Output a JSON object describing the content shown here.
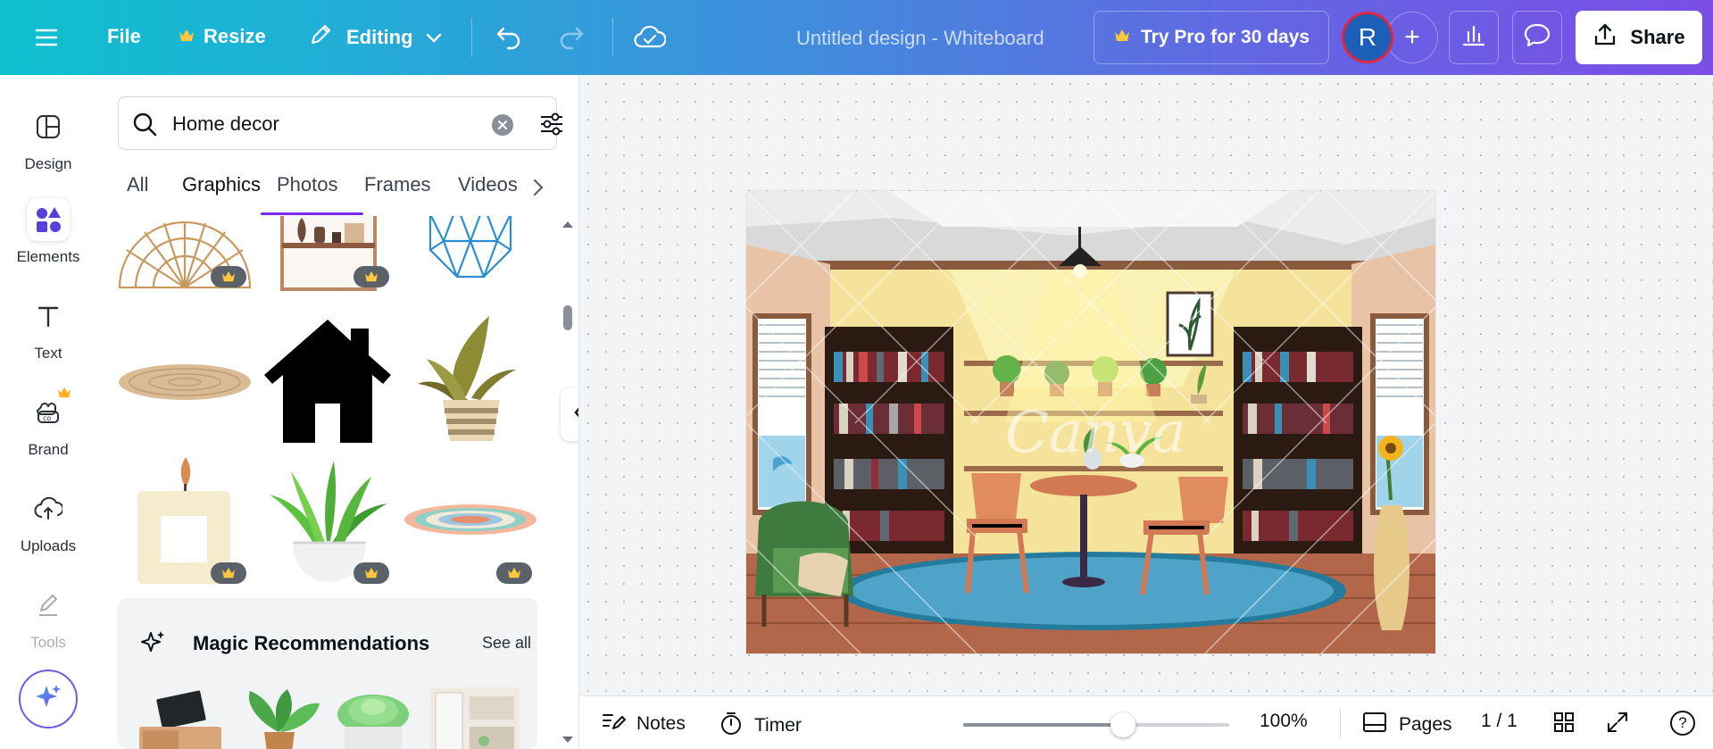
{
  "topbar": {
    "file_label": "File",
    "resize_label": "Resize",
    "editing_label": "Editing",
    "document_title": "Untitled design - Whiteboard",
    "pro_label": "Try Pro for 30 days",
    "avatar_initial": "R",
    "plus_symbol": "+",
    "share_label": "Share"
  },
  "rail": {
    "items": [
      {
        "label": "Design"
      },
      {
        "label": "Elements"
      },
      {
        "label": "Text"
      },
      {
        "label": "Brand"
      },
      {
        "label": "Uploads"
      },
      {
        "label": "Tools"
      }
    ]
  },
  "panel": {
    "search_value": "Home decor",
    "tabs": [
      "All",
      "Graphics",
      "Photos",
      "Frames",
      "Videos"
    ],
    "active_tab": "Graphics",
    "magic": {
      "title": "Magic Recommendations",
      "see_all": "See all"
    }
  },
  "canvas": {
    "watermark": "Canva"
  },
  "bottombar": {
    "notes_label": "Notes",
    "timer_label": "Timer",
    "zoom_label": "100%",
    "zoom_fraction": 0.6,
    "pages_label": "Pages",
    "page_count": "1 / 1",
    "help_symbol": "?"
  },
  "colors": {
    "accent": "#7d2ae8",
    "avatar_bg": "#1c5fb8",
    "avatar_ring": "#e0263f"
  }
}
